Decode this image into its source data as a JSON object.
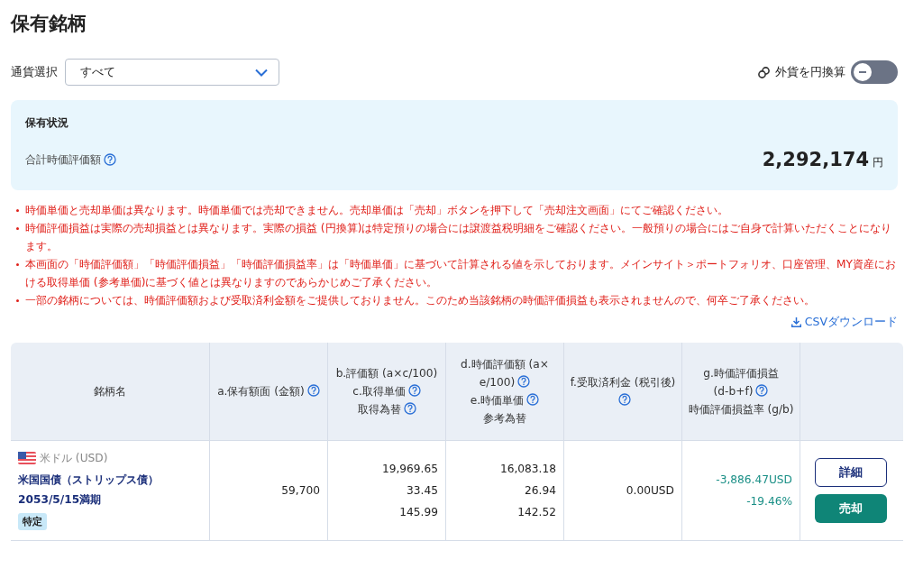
{
  "page_title": "保有銘柄",
  "currency_filter": {
    "label": "通貨選択",
    "value": "すべて"
  },
  "yen_toggle": {
    "label": "外貨を円換算",
    "on": false
  },
  "summary": {
    "title": "保有状況",
    "total_label": "合計時価評価額",
    "total_value": "2,292,174",
    "unit": "円"
  },
  "notes": [
    "時価単価と売却単価は異なります。時価単価では売却できません。売却単価は「売却」ボタンを押下して「売却注文画面」にてご確認ください。",
    "時価評価損益は実際の売却損益とは異なります。実際の損益 (円換算)は特定預りの場合には譲渡益税明細をご確認ください。一般預りの場合にはご自身で計算いただくことになります。",
    "本画面の「時価評価額」「時価評価損益」「時価評価損益率」は「時価単価」に基づいて計算される値を示しております。メインサイト＞ポートフォリオ、口座管理、MY資産における取得単価 (参考単価)に基づく値とは異なりますのであらかじめご了承ください。",
    "一部の銘柄については、時価評価額および受取済利金額をご提供しておりません。このため当該銘柄の時価評価損益も表示されませんので、何卒ご了承ください。"
  ],
  "csv_link": "CSVダウンロード",
  "table": {
    "columns": [
      {
        "lines": [
          {
            "text": "銘柄名",
            "help": false
          }
        ]
      },
      {
        "lines": [
          {
            "text": "a.保有額面 (金額)",
            "help": true
          }
        ]
      },
      {
        "lines": [
          {
            "text": "b.評価額 (a×c/100)",
            "help": false
          },
          {
            "text": "c.取得単価",
            "help": true
          },
          {
            "text": "取得為替",
            "help": true
          }
        ]
      },
      {
        "lines": [
          {
            "text": "d.時価評価額 (a×",
            "help": false
          },
          {
            "text": "e/100)",
            "help": true
          },
          {
            "text": "e.時価単価",
            "help": true
          },
          {
            "text": "参考為替",
            "help": false
          }
        ]
      },
      {
        "lines": [
          {
            "text": "f.受取済利金 (税引後)",
            "help": true
          }
        ]
      },
      {
        "lines": [
          {
            "text": "g.時価評価損益",
            "help": false
          },
          {
            "text": "(d-b+f)",
            "help": true
          },
          {
            "text": "時価評価損益率 (g/b)",
            "help": false
          }
        ]
      },
      {}
    ],
    "rows": [
      {
        "currency": "米ドル (USD)",
        "name": "米国国債（ストリップス債） 2053/5/15満期",
        "tag": "特定",
        "face_amount": "59,700",
        "valuation": [
          "19,969.65",
          "33.45",
          "145.99"
        ],
        "market_value": [
          "16,083.18",
          "26.94",
          "142.52"
        ],
        "interest": "0.00USD",
        "gain": [
          "-3,886.47USD",
          "-19.46%"
        ],
        "buttons": [
          {
            "kind": "outline",
            "label": "詳細"
          },
          {
            "kind": "primary",
            "label": "売却"
          }
        ]
      }
    ]
  }
}
